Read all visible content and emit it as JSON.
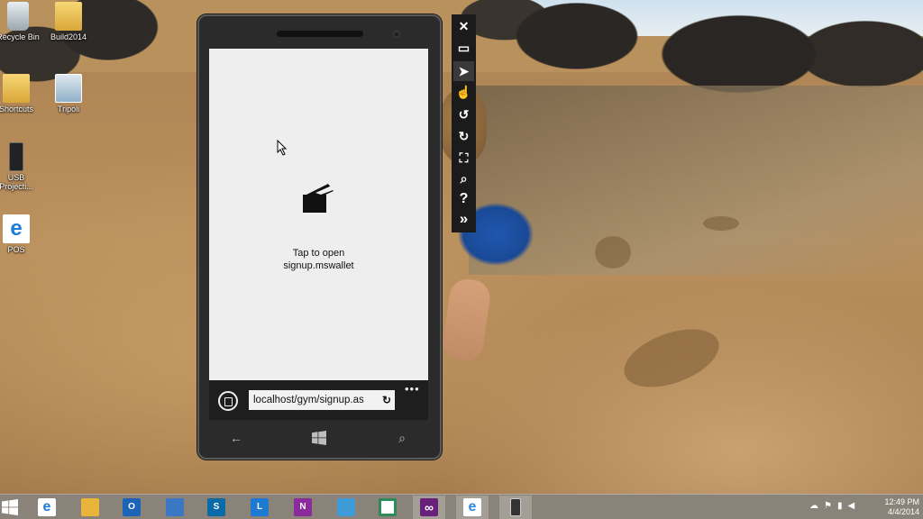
{
  "desktop": {
    "icons": [
      {
        "label": "Recycle Bin",
        "icon": "recycle-bin-icon"
      },
      {
        "label": "Build2014",
        "icon": "folder-icon"
      },
      {
        "label": "Shortcuts",
        "icon": "folder-icon"
      },
      {
        "label": "Tripoli",
        "icon": "settings-app-icon"
      },
      {
        "label": "USB\nProjecti...",
        "icon": "usb-drive-icon"
      },
      {
        "label": "POS",
        "icon": "internet-explorer-icon"
      }
    ]
  },
  "phone": {
    "tap_line1": "Tap to open",
    "tap_line2": "signup.mswallet",
    "url": "localhost/gym/signup.as",
    "more_label": "•••",
    "icons": [
      "tabs-icon",
      "refresh-icon",
      "back-icon",
      "windows-icon",
      "search-icon",
      "wallet-icon"
    ]
  },
  "emulator_toolbar": {
    "tools": [
      {
        "icon": "close-icon",
        "glyph": "✕"
      },
      {
        "icon": "minimize-icon",
        "glyph": "▭"
      },
      {
        "icon": "mouse-pointer-icon",
        "glyph": "➤"
      },
      {
        "icon": "touch-hand-icon",
        "glyph": "☝"
      },
      {
        "icon": "rotate-left-icon",
        "glyph": "↺"
      },
      {
        "icon": "rotate-right-icon",
        "glyph": "↻"
      },
      {
        "icon": "fit-to-screen-icon",
        "glyph": "⛶"
      },
      {
        "icon": "zoom-icon",
        "glyph": "⌕"
      },
      {
        "icon": "help-icon",
        "glyph": "?"
      },
      {
        "icon": "additional-tools-icon",
        "glyph": "»"
      }
    ]
  },
  "taskbar": {
    "apps": [
      {
        "icon": "internet-explorer-icon",
        "color": "#1e7bd6",
        "glyph": "e"
      },
      {
        "icon": "file-explorer-icon",
        "color": "#e9b43a",
        "glyph": ""
      },
      {
        "icon": "outlook-icon",
        "color": "#1b64b8",
        "glyph": "O"
      },
      {
        "icon": "remote-desktop-icon",
        "color": "#3a78c4",
        "glyph": ""
      },
      {
        "icon": "sharepoint-icon",
        "color": "#0a6aa8",
        "glyph": "S"
      },
      {
        "icon": "lync-icon",
        "color": "#1d7ad0",
        "glyph": "L"
      },
      {
        "icon": "onenote-icon",
        "color": "#8a2a9c",
        "glyph": "N"
      },
      {
        "icon": "photos-icon",
        "color": "#3f9bd8",
        "glyph": ""
      },
      {
        "icon": "window-app-icon",
        "color": "#2d8a5a",
        "glyph": ""
      },
      {
        "icon": "visual-studio-icon",
        "color": "#68217a",
        "glyph": "∞"
      },
      {
        "icon": "internet-explorer-icon",
        "color": "#2a8ae0",
        "glyph": "e"
      },
      {
        "icon": "phone-emulator-icon",
        "color": "#333333",
        "glyph": ""
      }
    ],
    "time": "12:49 PM",
    "date": "4/4/2014"
  }
}
